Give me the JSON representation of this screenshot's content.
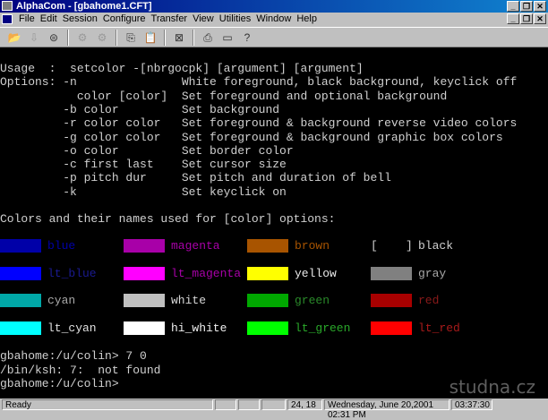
{
  "title": "AlphaCom - [gbahome1.CFT]",
  "menu": [
    "File",
    "Edit",
    "Session",
    "Configure",
    "Transfer",
    "View",
    "Utilities",
    "Window",
    "Help"
  ],
  "toolbar_icons": [
    "open-folder-icon",
    "connect-icon",
    "disconnect-icon",
    "gear-icon",
    "gears-icon",
    "copy-icon",
    "paste-icon",
    "target-icon",
    "print-icon",
    "window-icon",
    "help-icon"
  ],
  "terminal": {
    "lines": [
      "Usage  :  setcolor -[nbrgocpk] [argument] [argument]",
      "Options: -n               White foreground, black background, keyclick off",
      "           color [color]  Set foreground and optional background",
      "         -b color         Set background",
      "         -r color color   Set foreground & background reverse video colors",
      "         -g color color   Set foreground & background graphic box colors",
      "         -o color         Set border color",
      "         -c first last    Set cursor size",
      "         -p pitch dur     Set pitch and duration of bell",
      "         -k               Set keyclick on",
      "",
      "Colors and their names used for [color] options:"
    ],
    "colors": [
      [
        {
          "name": "blue",
          "swatch": "#0000a8",
          "text": "#0000a8"
        },
        {
          "name": "magenta",
          "swatch": "#a800a8",
          "text": "#a800a8"
        },
        {
          "name": "brown",
          "swatch": "#a85400",
          "text": "#a85400"
        },
        {
          "name": "black",
          "swatch": "#000000",
          "text": "#d0d0d0"
        }
      ],
      [
        {
          "name": "lt_blue",
          "swatch": "#0000ff",
          "text": "#1a1a90"
        },
        {
          "name": "lt_magenta",
          "swatch": "#ff00ff",
          "text": "#a800a8"
        },
        {
          "name": "yellow",
          "swatch": "#ffff00",
          "text": "#e8e8e8"
        },
        {
          "name": "gray",
          "swatch": "#808080",
          "text": "#a8a8a8"
        }
      ],
      [
        {
          "name": "cyan",
          "swatch": "#00a8a8",
          "text": "#a8a8a8"
        },
        {
          "name": "white",
          "swatch": "#c0c0c0",
          "text": "#d8d8d8"
        },
        {
          "name": "green",
          "swatch": "#00a800",
          "text": "#2a8a2a"
        },
        {
          "name": "red",
          "swatch": "#a80000",
          "text": "#8a1a1a"
        }
      ],
      [
        {
          "name": "lt_cyan",
          "swatch": "#00ffff",
          "text": "#e0e0e0"
        },
        {
          "name": "hi_white",
          "swatch": "#ffffff",
          "text": "#f0f0f0"
        },
        {
          "name": "lt_green",
          "swatch": "#00ff00",
          "text": "#2aa82a"
        },
        {
          "name": "lt_red",
          "swatch": "#ff0000",
          "text": "#a81a1a"
        }
      ]
    ],
    "black_brackets": "[    ]",
    "prompt_lines": [
      "gbahome:/u/colin> 7 0",
      "/bin/ksh: 7:  not found",
      "gbahome:/u/colin>"
    ]
  },
  "status": {
    "ready": "Ready",
    "cursor": "24, 18",
    "datetime": "Wednesday, June 20,2001  02:31 PM",
    "elapsed": "03:37:30"
  },
  "watermark": "studna.cz"
}
